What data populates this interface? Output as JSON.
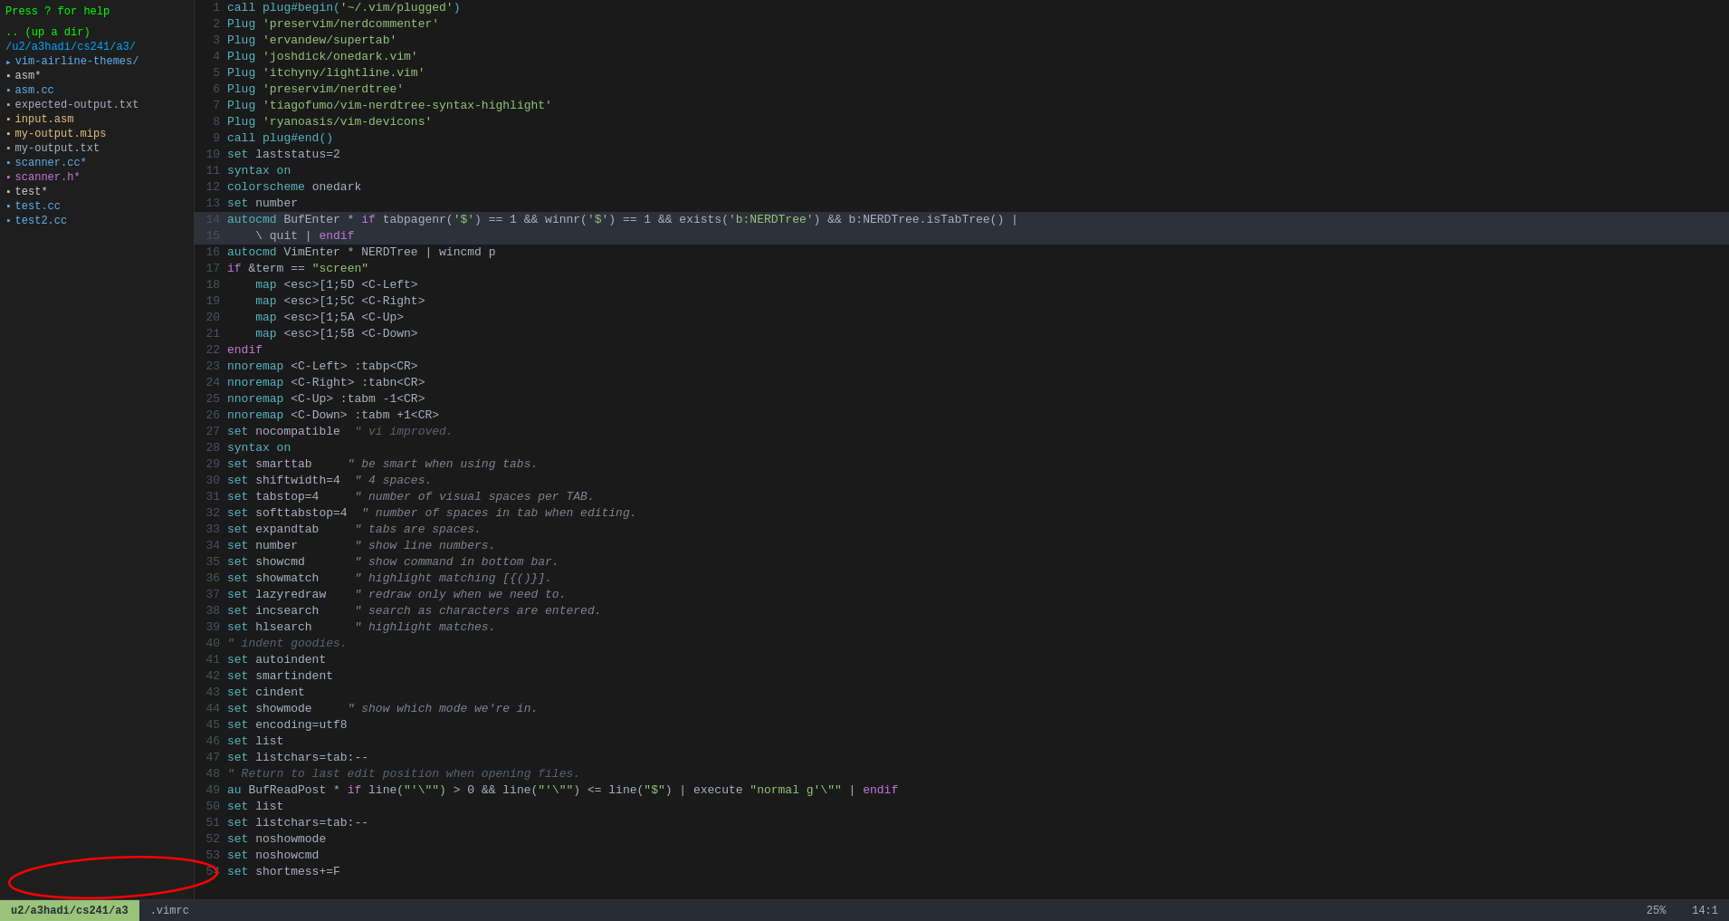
{
  "sidebar": {
    "help": "Press ? for help",
    "blank": "",
    "updir": ".. (up a dir)",
    "path1": "/u2/a3hadi/cs241/a3/",
    "items": [
      {
        "name": "vim-airline-themes/",
        "type": "folder",
        "indent": 0
      },
      {
        "name": "asm*",
        "type": "file-exec",
        "indent": 1
      },
      {
        "name": "asm.cc",
        "type": "file-cc",
        "indent": 1
      },
      {
        "name": "expected-output.txt",
        "type": "file-txt",
        "indent": 1
      },
      {
        "name": "input.asm",
        "type": "file-asm",
        "indent": 1
      },
      {
        "name": "my-output.mips",
        "type": "file-mips",
        "indent": 1
      },
      {
        "name": "my-output.txt",
        "type": "file-txt",
        "indent": 1
      },
      {
        "name": "scanner.cc*",
        "type": "file-cc",
        "indent": 1
      },
      {
        "name": "scanner.h*",
        "type": "file-h",
        "indent": 1
      },
      {
        "name": "test*",
        "type": "file-exec",
        "indent": 1
      },
      {
        "name": "test.cc",
        "type": "file-cc",
        "indent": 1
      },
      {
        "name": "test2.cc",
        "type": "file-cc",
        "indent": 1
      }
    ]
  },
  "lines": [
    {
      "num": 1,
      "text": "call plug#begin('~/.vim/plugged')"
    },
    {
      "num": 2,
      "text": "Plug 'preservim/nerdcommenter'"
    },
    {
      "num": 3,
      "text": "Plug 'ervandew/supertab'"
    },
    {
      "num": 4,
      "text": "Plug 'joshdick/onedark.vim'"
    },
    {
      "num": 5,
      "text": "Plug 'itchyny/lightline.vim'"
    },
    {
      "num": 6,
      "text": "Plug 'preservim/nerdtree'"
    },
    {
      "num": 7,
      "text": "Plug 'tiagofumo/vim-nerdtree-syntax-highlight'"
    },
    {
      "num": 8,
      "text": "Plug 'ryanoasis/vim-devicons'"
    },
    {
      "num": 9,
      "text": "call plug#end()"
    },
    {
      "num": 10,
      "text": "set laststatus=2"
    },
    {
      "num": 11,
      "text": "syntax on"
    },
    {
      "num": 12,
      "text": "colorscheme onedark"
    },
    {
      "num": 13,
      "text": "set number"
    },
    {
      "num": 14,
      "text": "autocmd BufEnter * if tabpagenr('$') == 1 && winnr('$') == 1 && exists('b:NERDTree') && b:NERDTree.isTabTree() |",
      "highlight": true
    },
    {
      "num": 15,
      "text": "    \\ quit | endif",
      "highlight": true
    },
    {
      "num": 16,
      "text": "autocmd VimEnter * NERDTree | wincmd p"
    },
    {
      "num": 17,
      "text": "if &term == \"screen\""
    },
    {
      "num": 18,
      "text": "    map <esc>[1;5D <C-Left>"
    },
    {
      "num": 19,
      "text": "    map <esc>[1;5C <C-Right>"
    },
    {
      "num": 20,
      "text": "    map <esc>[1;5A <C-Up>"
    },
    {
      "num": 21,
      "text": "    map <esc>[1;5B <C-Down>"
    },
    {
      "num": 22,
      "text": "endif"
    },
    {
      "num": 23,
      "text": "nnoremap <C-Left> :tabp<CR>"
    },
    {
      "num": 24,
      "text": "nnoremap <C-Right> :tabn<CR>"
    },
    {
      "num": 25,
      "text": "nnoremap <C-Up> :tabm -1<CR>"
    },
    {
      "num": 26,
      "text": "nnoremap <C-Down> :tabm +1<CR>"
    },
    {
      "num": 27,
      "text": "set nocompatible  \" vi improved."
    },
    {
      "num": 28,
      "text": "syntax on"
    },
    {
      "num": 29,
      "text": "set smarttab     \" be smart when using tabs."
    },
    {
      "num": 30,
      "text": "set shiftwidth=4  \" 4 spaces."
    },
    {
      "num": 31,
      "text": "set tabstop=4     \" number of visual spaces per TAB."
    },
    {
      "num": 32,
      "text": "set softtabstop=4  \" number of spaces in tab when editing."
    },
    {
      "num": 33,
      "text": "set expandtab     \" tabs are spaces."
    },
    {
      "num": 34,
      "text": "set number        \" show line numbers."
    },
    {
      "num": 35,
      "text": "set showcmd       \" show command in bottom bar."
    },
    {
      "num": 36,
      "text": "set showmatch     \" highlight matching [{()}]."
    },
    {
      "num": 37,
      "text": "set lazyredraw    \" redraw only when we need to."
    },
    {
      "num": 38,
      "text": "set incsearch     \" search as characters are entered."
    },
    {
      "num": 39,
      "text": "set hlsearch      \" highlight matches."
    },
    {
      "num": 40,
      "text": "\" indent goodies."
    },
    {
      "num": 41,
      "text": "set autoindent"
    },
    {
      "num": 42,
      "text": "set smartindent"
    },
    {
      "num": 43,
      "text": "set cindent"
    },
    {
      "num": 44,
      "text": "set showmode     \" show which mode we're in."
    },
    {
      "num": 45,
      "text": "set encoding=utf8"
    },
    {
      "num": 46,
      "text": "set list"
    },
    {
      "num": 47,
      "text": "set listchars=tab:--"
    },
    {
      "num": 48,
      "text": "\" Return to last edit position when opening files."
    },
    {
      "num": 49,
      "text": "au BufReadPost * if line(\"'\\\"\") > 0 && line(\"'\\\"\") <= line(\"$\") | execute \"normal g'\\\"\" | endif"
    },
    {
      "num": 50,
      "text": "set list"
    },
    {
      "num": 51,
      "text": "set listchars=tab:--"
    },
    {
      "num": 52,
      "text": "set noshowmode"
    },
    {
      "num": 53,
      "text": "set noshowcmd"
    },
    {
      "num": 54,
      "text": "set shortmess+=F"
    }
  ],
  "status": {
    "left_label": "u2/a3hadi/cs241/a3",
    "filename": ".vimrc",
    "percent": "25%",
    "position": "14:1"
  }
}
